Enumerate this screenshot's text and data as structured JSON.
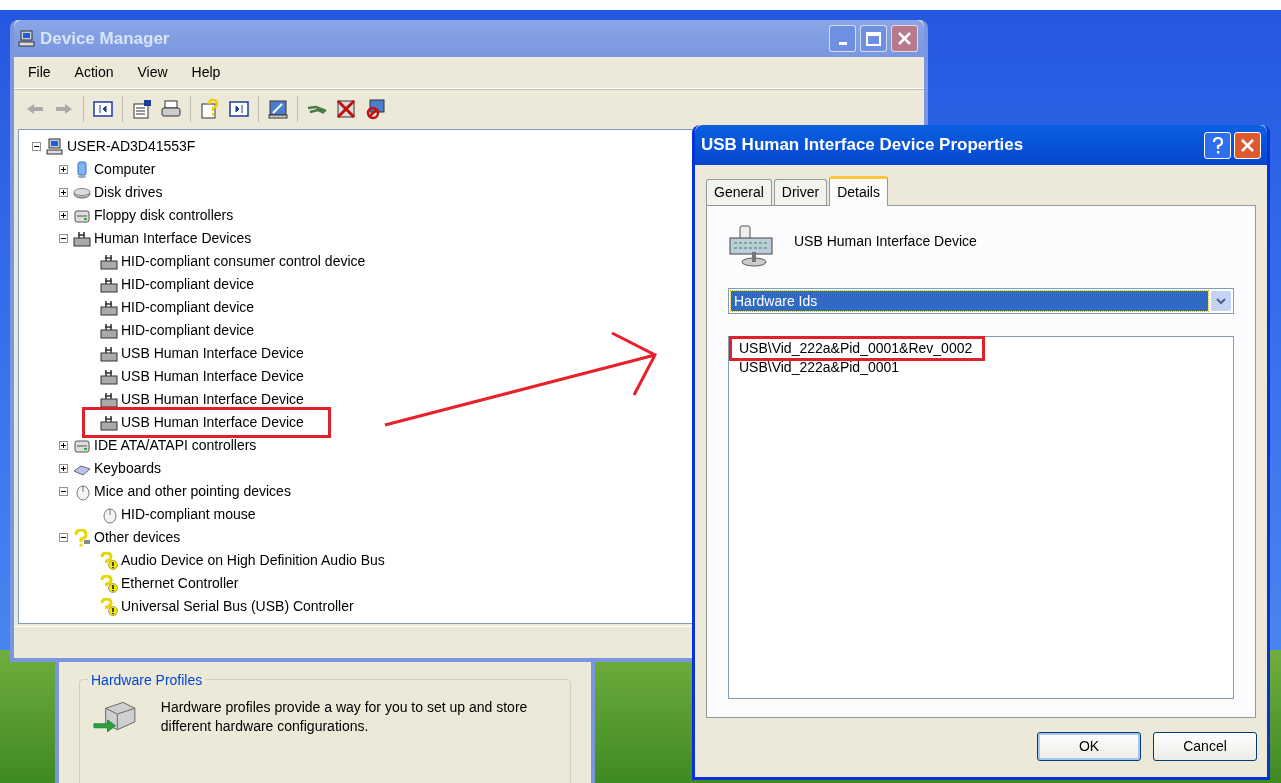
{
  "device_manager": {
    "title": "Device Manager",
    "active": false,
    "menu": [
      "File",
      "Action",
      "View",
      "Help"
    ],
    "tree": {
      "label": "USER-AD3D41553F",
      "kind": "computer",
      "expanded": true,
      "highlighted": false,
      "children": [
        {
          "label": "Computer",
          "kind": "monitor",
          "expanded": false,
          "highlighted": false
        },
        {
          "label": "Disk drives",
          "kind": "disk",
          "expanded": false,
          "highlighted": false
        },
        {
          "label": "Floppy disk controllers",
          "kind": "controller",
          "expanded": false,
          "highlighted": false
        },
        {
          "label": "Human Interface Devices",
          "kind": "hid",
          "expanded": true,
          "highlighted": false,
          "children": [
            {
              "label": "HID-compliant consumer control device",
              "kind": "hid",
              "highlighted": false
            },
            {
              "label": "HID-compliant device",
              "kind": "hid",
              "highlighted": false
            },
            {
              "label": "HID-compliant device",
              "kind": "hid",
              "highlighted": false
            },
            {
              "label": "HID-compliant device",
              "kind": "hid",
              "highlighted": false
            },
            {
              "label": "USB Human Interface Device",
              "kind": "hid",
              "highlighted": false
            },
            {
              "label": "USB Human Interface Device",
              "kind": "hid",
              "highlighted": false
            },
            {
              "label": "USB Human Interface Device",
              "kind": "hid",
              "highlighted": false
            },
            {
              "label": "USB Human Interface Device",
              "kind": "hid",
              "highlighted": true
            }
          ]
        },
        {
          "label": "IDE ATA/ATAPI controllers",
          "kind": "controller",
          "expanded": false,
          "highlighted": false
        },
        {
          "label": "Keyboards",
          "kind": "keyboard",
          "expanded": false,
          "highlighted": false
        },
        {
          "label": "Mice and other pointing devices",
          "kind": "mouse",
          "expanded": true,
          "highlighted": false,
          "children": [
            {
              "label": "HID-compliant mouse",
              "kind": "mouse",
              "highlighted": false
            }
          ]
        },
        {
          "label": "Other devices",
          "kind": "unknown",
          "expanded": true,
          "highlighted": false,
          "children": [
            {
              "label": "Audio Device on High Definition Audio Bus",
              "kind": "warning",
              "highlighted": false
            },
            {
              "label": "Ethernet Controller",
              "kind": "warning",
              "highlighted": false
            },
            {
              "label": "Universal Serial Bus (USB) Controller",
              "kind": "warning",
              "highlighted": false
            }
          ]
        }
      ]
    }
  },
  "background_window": {
    "group_title": "Hardware Profiles",
    "text": "Hardware profiles provide a way for you to set up and store different hardware configurations."
  },
  "properties_dialog": {
    "title": "USB Human Interface Device Properties",
    "active": true,
    "tabs": [
      {
        "label": "General",
        "selected": false
      },
      {
        "label": "Driver",
        "selected": false
      },
      {
        "label": "Details",
        "selected": true
      }
    ],
    "device_name": "USB Human Interface Device",
    "property": "Hardware Ids",
    "values": [
      {
        "text": "USB\\Vid_222a&Pid_0001&Rev_0002",
        "highlighted": true
      },
      {
        "text": "USB\\Vid_222a&Pid_0001",
        "highlighted": false
      }
    ],
    "buttons": [
      {
        "label": "OK",
        "default": true
      },
      {
        "label": "Cancel",
        "default": false
      }
    ]
  }
}
